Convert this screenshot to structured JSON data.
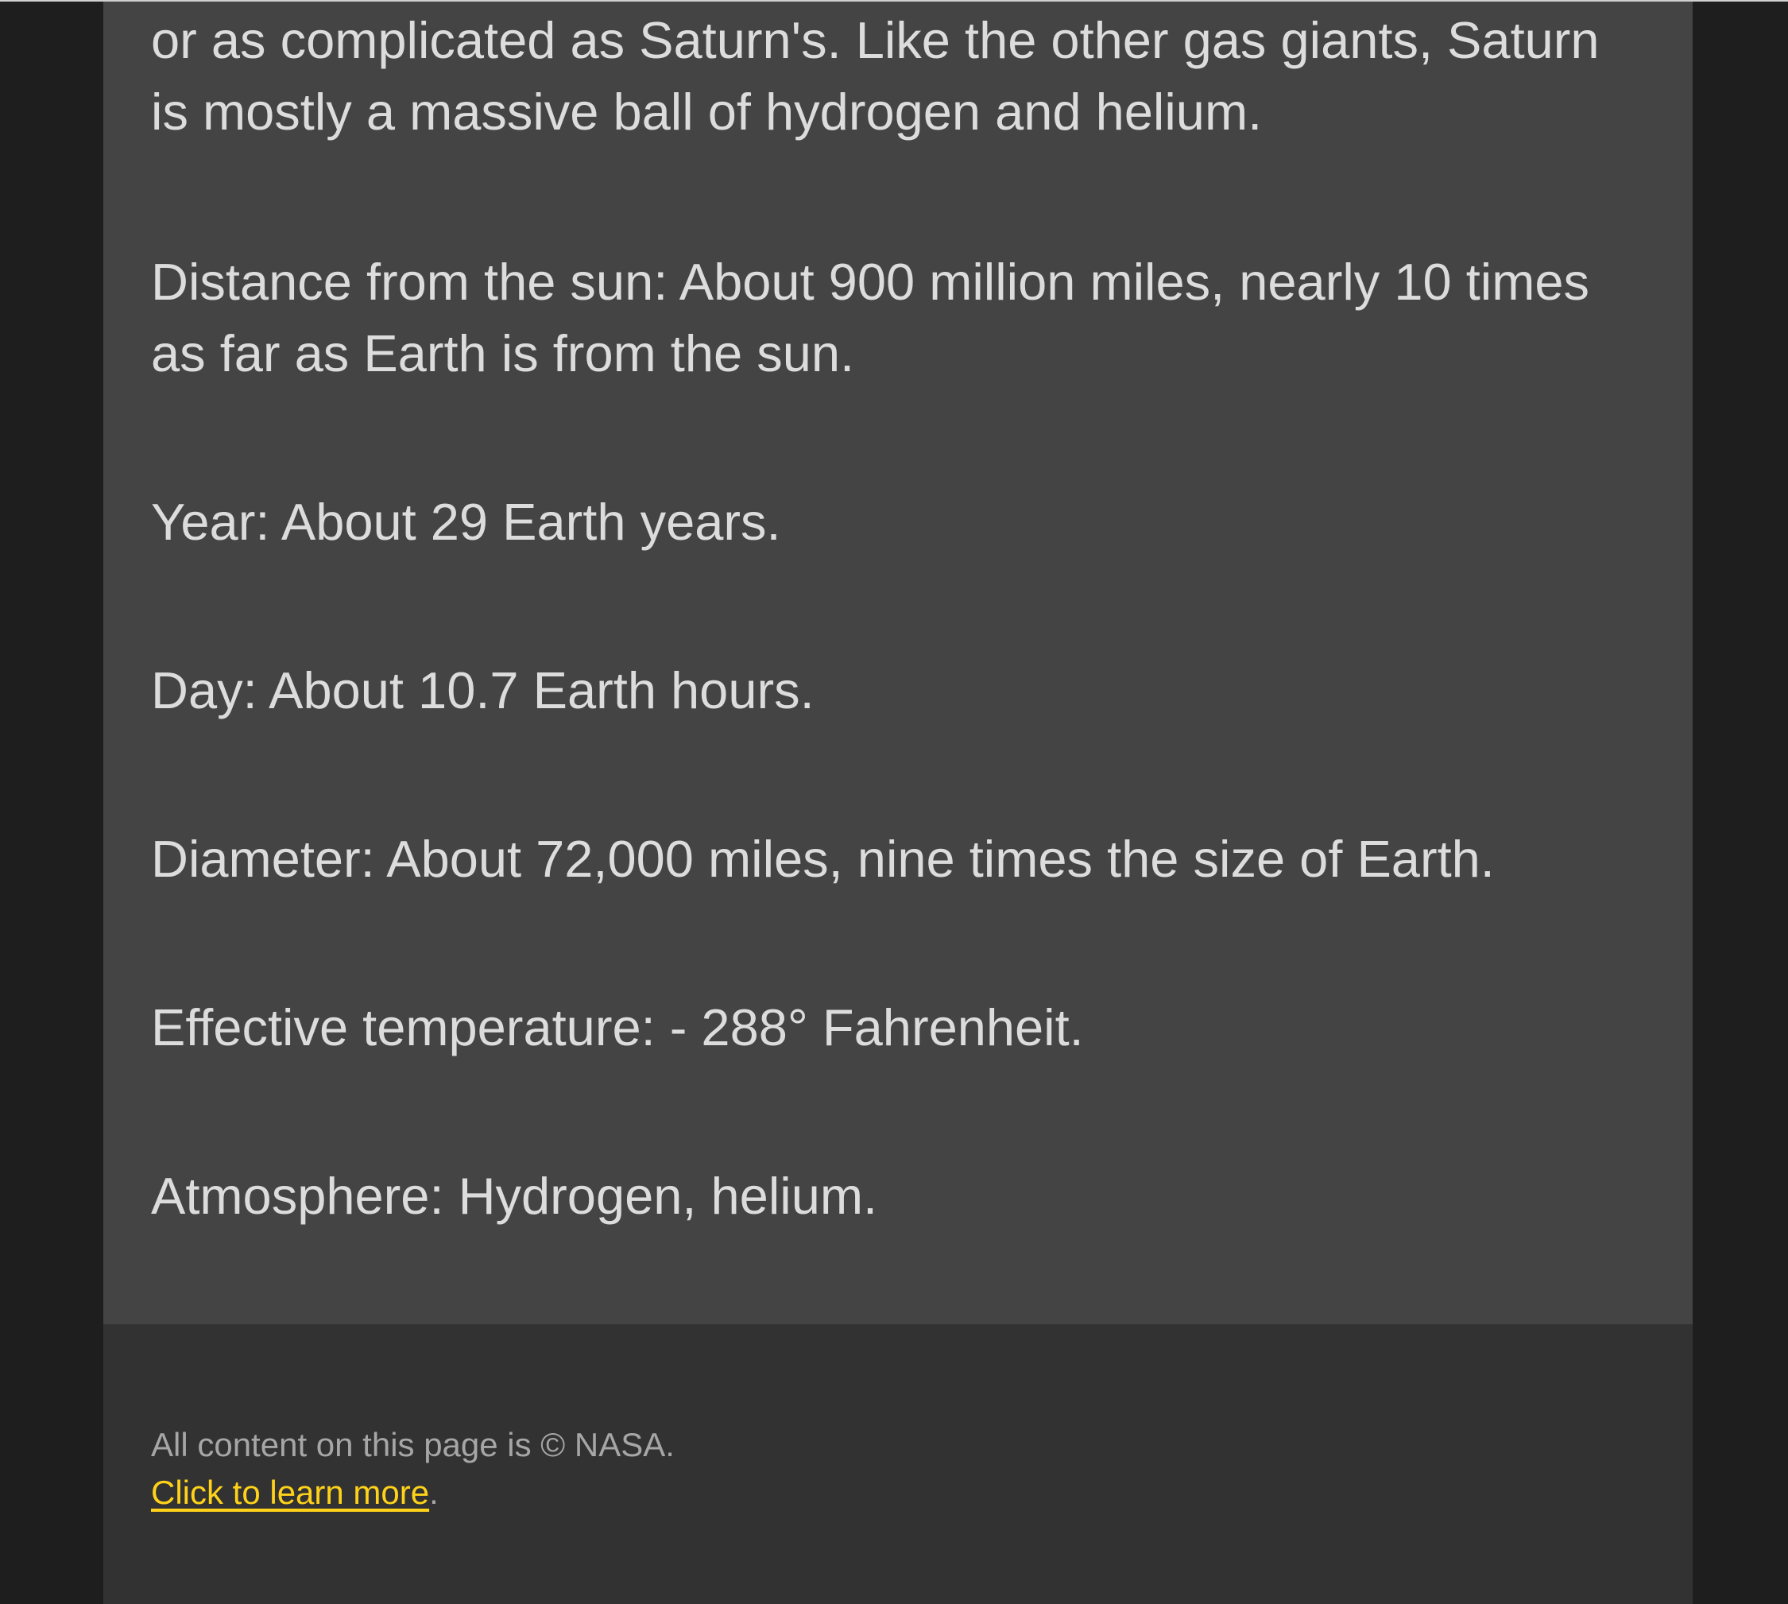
{
  "article": {
    "intro": "or as complicated as Saturn's. Like the other gas giants, Saturn is mostly a massive ball of hydrogen and helium.",
    "distance": "Distance from the sun: About 900 million miles, nearly 10 times as far as Earth is from the sun.",
    "year": "Year: About 29 Earth years.",
    "day": "Day: About 10.7 Earth hours.",
    "diameter": "Diameter: About 72,000 miles, nine times the size of Earth.",
    "temperature": "Effective temperature: - 288° Fahrenheit.",
    "atmosphere": "Atmosphere: Hydrogen, helium."
  },
  "footer": {
    "copyright": "All content on this page is © NASA.",
    "link_text": "Click to learn more",
    "link_suffix": "."
  },
  "colors": {
    "page_background": "#1e1e1e",
    "content_background": "#444444",
    "footer_background": "#323232",
    "body_text": "#dcdcdc",
    "footer_text": "#a6a6a6",
    "link": "#ffd21a"
  }
}
